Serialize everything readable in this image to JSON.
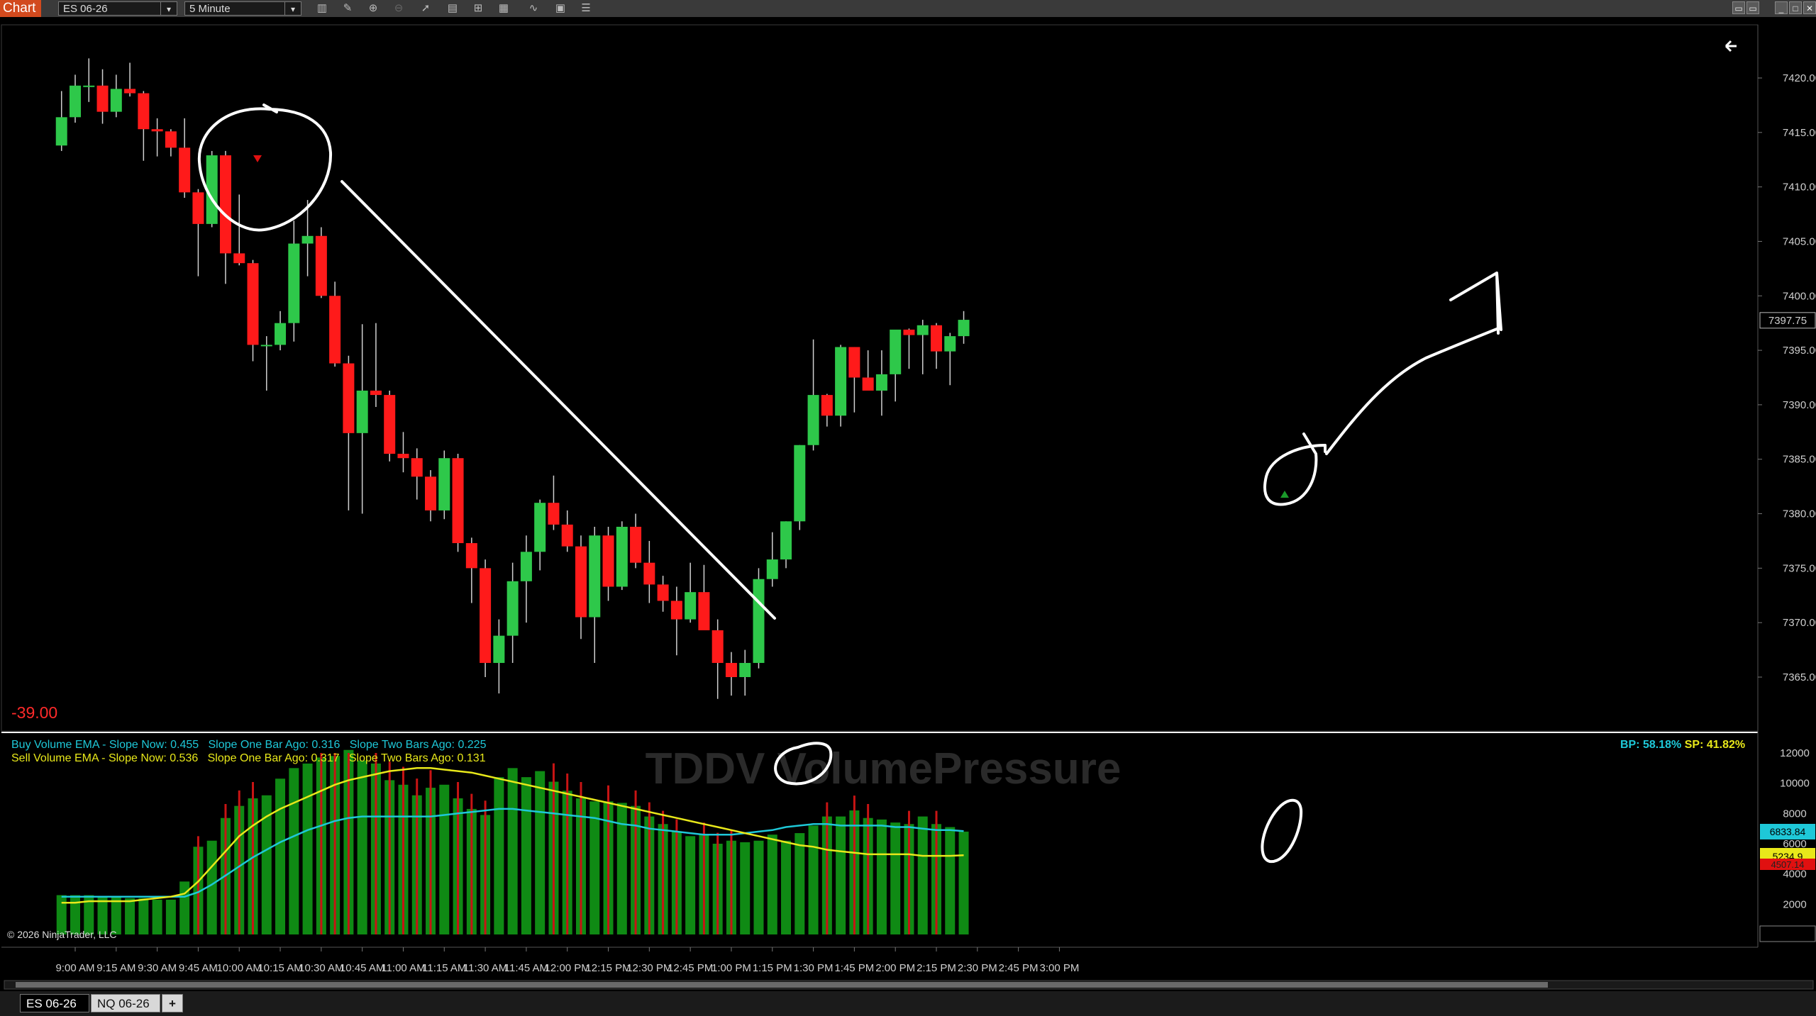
{
  "toolbar": {
    "chart_label": "Chart",
    "instrument": "ES 06-26",
    "interval": "5 Minute",
    "icons": [
      "bars-type-icon",
      "draw-pencil-icon",
      "zoom-in-icon",
      "zoom-out-icon",
      "pointer-icon",
      "properties-icon",
      "templates-icon",
      "strategy-icon",
      "indicators-icon",
      "drawing-tools-icon",
      "data-box-icon"
    ],
    "window_buttons": [
      "restore-icon",
      "maximize-icon",
      "close-icon"
    ]
  },
  "price_panel": {
    "pnl_text": "-39.00",
    "current_price": "7397.75",
    "y_ticks": [
      "7420.00",
      "7415.00",
      "7410.00",
      "7405.00",
      "7400.00",
      "7395.00",
      "7390.00",
      "7385.00",
      "7380.00",
      "7375.00",
      "7370.00",
      "7365.00"
    ],
    "back_icon": "arrow-left-icon"
  },
  "indicator_panel": {
    "watermark": "TDDV VolumePressure",
    "buy_line": {
      "name": "Buy Volume EMA",
      "slope_now": "Buy Volume EMA - Slope Now: 0.455",
      "one_bar": "Slope One Bar Ago: 0.316",
      "two_bars": "Slope Two Bars Ago: 0.225"
    },
    "sell_line": {
      "name": "Sell Volume EMA",
      "slope_now": "Sell Volume EMA - Slope Now: 0.536",
      "one_bar": "Slope One Bar Ago: 0.317",
      "two_bars": "Slope Two Bars Ago: 0.131"
    },
    "bp_text": "BP: 58.18%",
    "sp_text": "SP: 41.82%",
    "y_ticks": [
      "12000",
      "10000",
      "8000",
      "6000",
      "4000",
      "2000",
      "0"
    ],
    "marker_buy": "6833.84",
    "marker_sell": "5234.9",
    "marker_red": "4507.14",
    "copyright": "© 2026 NinjaTrader, LLC"
  },
  "x_axis": {
    "labels": [
      "9:00 AM",
      "9:15 AM",
      "9:30 AM",
      "9:45 AM",
      "10:00 AM",
      "10:15 AM",
      "10:30 AM",
      "10:45 AM",
      "11:00 AM",
      "11:15 AM",
      "11:30 AM",
      "11:45 AM",
      "12:00 PM",
      "12:15 PM",
      "12:30 PM",
      "12:45 PM",
      "1:00 PM",
      "1:15 PM",
      "1:30 PM",
      "1:45 PM",
      "2:00 PM",
      "2:15 PM",
      "2:30 PM",
      "2:45 PM",
      "3:00 PM"
    ]
  },
  "bottom_tabs": {
    "tab1": "ES 06-26",
    "tab2": "NQ 06-26",
    "add": "+"
  },
  "colors": {
    "up": "#2ec84a",
    "down": "#ff1a1a",
    "buy_ema": "#1ec8d8",
    "sell_ema": "#e8e81a",
    "vol_bar": "#0f8a14",
    "wick": "#d0d0d0"
  },
  "chart_data": {
    "type": "candlestick",
    "start_time": "8:55 AM",
    "interval_minutes": 5,
    "ohlc": [
      [
        7413.8,
        7418.8,
        7413.3,
        7416.4
      ],
      [
        7416.4,
        7420.3,
        7415.9,
        7419.3
      ],
      [
        7419.3,
        7421.8,
        7417.8,
        7419.3
      ],
      [
        7419.3,
        7420.8,
        7415.8,
        7416.9
      ],
      [
        7416.9,
        7420.3,
        7416.4,
        7419.0
      ],
      [
        7419.0,
        7421.4,
        7418.3,
        7418.6
      ],
      [
        7418.6,
        7418.8,
        7412.4,
        7415.3
      ],
      [
        7415.3,
        7416.3,
        7412.8,
        7415.1
      ],
      [
        7415.1,
        7415.3,
        7412.8,
        7413.6
      ],
      [
        7413.6,
        7416.3,
        7409.0,
        7409.5
      ],
      [
        7409.5,
        7409.8,
        7401.8,
        7406.6
      ],
      [
        7406.6,
        7413.3,
        7406.3,
        7412.9
      ],
      [
        7412.9,
        7413.3,
        7401.1,
        7403.9
      ],
      [
        7403.9,
        7409.3,
        7402.8,
        7403.0
      ],
      [
        7403.0,
        7403.3,
        7394.0,
        7395.5
      ],
      [
        7395.5,
        7396.3,
        7391.3,
        7395.5
      ],
      [
        7395.5,
        7398.6,
        7395.0,
        7397.5
      ],
      [
        7397.5,
        7406.9,
        7395.8,
        7404.8
      ],
      [
        7404.8,
        7408.8,
        7401.8,
        7405.5
      ],
      [
        7405.5,
        7406.3,
        7399.8,
        7400.0
      ],
      [
        7400.0,
        7401.3,
        7393.5,
        7393.8
      ],
      [
        7393.8,
        7394.5,
        7380.3,
        7387.4
      ],
      [
        7387.4,
        7397.4,
        7380.0,
        7391.3
      ],
      [
        7391.3,
        7397.5,
        7389.8,
        7390.9
      ],
      [
        7390.9,
        7391.3,
        7384.8,
        7385.5
      ],
      [
        7385.5,
        7387.5,
        7383.8,
        7385.1
      ],
      [
        7385.1,
        7386.0,
        7381.3,
        7383.4
      ],
      [
        7383.4,
        7384.0,
        7379.3,
        7380.3
      ],
      [
        7380.3,
        7385.8,
        7379.5,
        7385.1
      ],
      [
        7385.1,
        7385.5,
        7376.5,
        7377.3
      ],
      [
        7377.3,
        7377.8,
        7371.8,
        7375.0
      ],
      [
        7375.0,
        7375.8,
        7365.0,
        7366.3
      ],
      [
        7366.3,
        7370.3,
        7363.5,
        7368.8
      ],
      [
        7368.8,
        7375.5,
        7366.3,
        7373.8
      ],
      [
        7373.8,
        7378.0,
        7370.0,
        7376.5
      ],
      [
        7376.5,
        7381.3,
        7374.8,
        7381.0
      ],
      [
        7381.0,
        7383.5,
        7378.5,
        7379.0
      ],
      [
        7379.0,
        7380.3,
        7376.5,
        7377.0
      ],
      [
        7377.0,
        7378.0,
        7368.5,
        7370.5
      ],
      [
        7370.5,
        7378.8,
        7366.3,
        7378.0
      ],
      [
        7378.0,
        7378.8,
        7372.0,
        7373.3
      ],
      [
        7373.3,
        7379.3,
        7373.0,
        7378.8
      ],
      [
        7378.8,
        7380.0,
        7375.0,
        7375.5
      ],
      [
        7375.5,
        7377.5,
        7371.8,
        7373.5
      ],
      [
        7373.5,
        7374.3,
        7371.0,
        7372.0
      ],
      [
        7372.0,
        7373.3,
        7367.0,
        7370.3
      ],
      [
        7370.3,
        7375.5,
        7370.0,
        7372.8
      ],
      [
        7372.8,
        7375.3,
        7369.5,
        7369.3
      ],
      [
        7369.3,
        7370.3,
        7363.0,
        7366.3
      ],
      [
        7366.3,
        7367.3,
        7363.3,
        7365.0
      ],
      [
        7365.0,
        7367.5,
        7363.3,
        7366.3
      ],
      [
        7366.3,
        7375.0,
        7365.8,
        7374.0
      ],
      [
        7374.0,
        7378.3,
        7373.3,
        7375.8
      ],
      [
        7375.8,
        7379.3,
        7375.0,
        7379.3
      ],
      [
        7379.3,
        7386.3,
        7378.5,
        7386.3
      ],
      [
        7386.3,
        7396.0,
        7385.8,
        7390.9
      ],
      [
        7390.9,
        7391.0,
        7388.0,
        7389.0
      ],
      [
        7389.0,
        7395.5,
        7388.0,
        7395.3
      ],
      [
        7395.3,
        7395.3,
        7389.3,
        7392.5
      ],
      [
        7392.5,
        7395.0,
        7391.8,
        7391.3
      ],
      [
        7391.3,
        7395.0,
        7389.0,
        7392.8
      ],
      [
        7392.8,
        7396.8,
        7390.3,
        7396.9
      ],
      [
        7396.9,
        7397.0,
        7393.3,
        7396.4
      ],
      [
        7396.4,
        7397.8,
        7392.8,
        7397.3
      ],
      [
        7397.3,
        7397.5,
        7393.3,
        7394.9
      ],
      [
        7394.9,
        7396.6,
        7391.8,
        7396.3
      ],
      [
        7396.3,
        7398.6,
        7395.6,
        7397.8
      ]
    ],
    "volume": [
      2600,
      2600,
      2600,
      2500,
      2500,
      2400,
      2400,
      2300,
      2300,
      3500,
      5800,
      6200,
      7700,
      8500,
      9000,
      9200,
      10300,
      11000,
      11300,
      11700,
      11800,
      12200,
      11500,
      11300,
      10200,
      9900,
      9200,
      9700,
      9900,
      9000,
      8300,
      7900,
      10400,
      11000,
      10400,
      10800,
      10100,
      9500,
      9000,
      8800,
      8800,
      8700,
      8500,
      7800,
      7300,
      6800,
      6500,
      6600,
      6000,
      6200,
      6100,
      6200,
      6600,
      6200,
      6700,
      7200,
      7800,
      7800,
      8200,
      7700,
      7600,
      7400,
      7300,
      7800,
      7300,
      7100,
      6800
    ],
    "buy_volume_ema": [
      2500,
      2500,
      2500,
      2500,
      2500,
      2500,
      2500,
      2500,
      2500,
      2500,
      2800,
      3300,
      3900,
      4500,
      5100,
      5600,
      6100,
      6500,
      6900,
      7200,
      7500,
      7700,
      7800,
      7800,
      7800,
      7800,
      7800,
      7800,
      7900,
      8000,
      8100,
      8200,
      8300,
      8300,
      8200,
      8100,
      8000,
      7900,
      7800,
      7700,
      7500,
      7300,
      7200,
      7000,
      6900,
      6800,
      6700,
      6600,
      6600,
      6600,
      6700,
      6800,
      6900,
      7100,
      7200,
      7300,
      7300,
      7200,
      7200,
      7200,
      7200,
      7100,
      7100,
      7000,
      6900,
      6900,
      6834
    ],
    "sell_volume_ema": [
      2100,
      2100,
      2200,
      2200,
      2200,
      2200,
      2300,
      2400,
      2500,
      2700,
      3500,
      4500,
      5500,
      6500,
      7200,
      7800,
      8300,
      8700,
      9100,
      9500,
      9900,
      10200,
      10400,
      10600,
      10800,
      10900,
      11000,
      11000,
      10900,
      10800,
      10700,
      10500,
      10300,
      10100,
      9900,
      9700,
      9500,
      9300,
      9100,
      8900,
      8700,
      8500,
      8300,
      8100,
      7900,
      7700,
      7500,
      7300,
      7100,
      6900,
      6700,
      6500,
      6300,
      6100,
      5900,
      5800,
      5600,
      5500,
      5400,
      5300,
      5300,
      5300,
      5300,
      5200,
      5200,
      5200,
      5235
    ]
  }
}
